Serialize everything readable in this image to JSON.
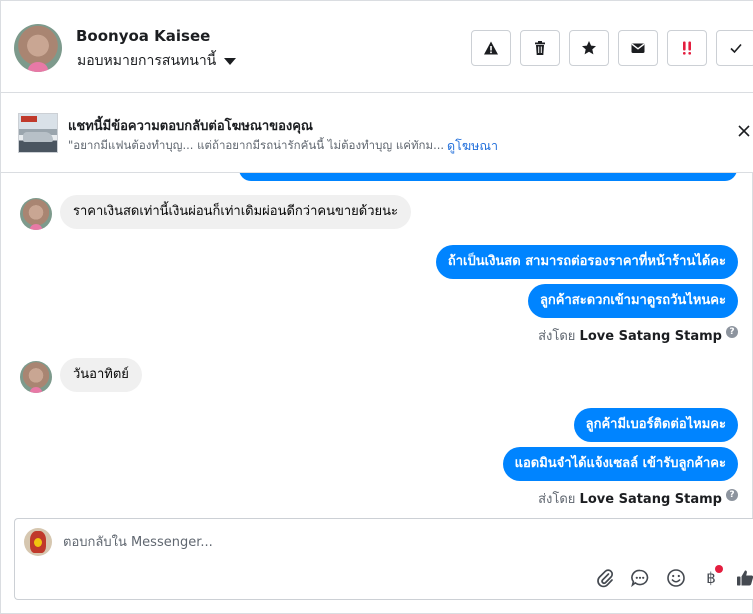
{
  "header": {
    "customer_name": "Boonyoa Kaisee",
    "assign_label": "มอบหมายการสนทนานี้",
    "actions": [
      {
        "name": "spam-button",
        "icon": "warning-icon"
      },
      {
        "name": "delete-button",
        "icon": "trash-icon"
      },
      {
        "name": "star-button",
        "icon": "star-icon"
      },
      {
        "name": "mark-unread-button",
        "icon": "envelope-icon"
      },
      {
        "name": "follow-up-button",
        "icon": "double-exclamation-icon"
      },
      {
        "name": "mark-done-button",
        "icon": "check-icon"
      }
    ]
  },
  "ad_banner": {
    "title": "แชทนี้มีข้อความตอบกลับต่อโฆษณาของคุณ",
    "preview": "\"อยากมีแฟนต้องทำบุญ... แต่ถ้าอยากมีรถน่ารักคันนี้ ไม่ต้องทำบุญ แค่ทักม...",
    "link": "ดูโฆษณา"
  },
  "thread": {
    "messages": [
      {
        "direction": "in",
        "text": "ราคาเงินสดเท่านี้เงินผ่อนก็เท่าเดิมผ่อนดีกว่าคนขายด้วยนะ"
      },
      {
        "direction": "out",
        "text": "ถ้าเป็นเงินสด สามารถต่อรองราคาที่หน้าร้านได้คะ"
      },
      {
        "direction": "out",
        "text": "ลูกค้าสะดวกเข้ามาดูรถวันไหนคะ"
      },
      {
        "direction": "in",
        "text": "วันอาทิตย์"
      },
      {
        "direction": "out",
        "text": "ลูกค้ามีเบอร์ติดต่อไหมคะ"
      },
      {
        "direction": "out",
        "text": "แอดมินจำได้แจ้งเซลล์ เข้ารับลูกค้าคะ"
      }
    ],
    "sent_by_prefix": "ส่งโดย",
    "sent_by_name": "Love Satang Stamp",
    "info_glyph": "?"
  },
  "composer": {
    "placeholder": "ตอบกลับใน Messenger...",
    "baht_glyph": "฿",
    "tools": [
      "paperclip-icon",
      "saved-reply-icon",
      "emoji-icon",
      "payment-icon",
      "thumbs-up-icon"
    ]
  },
  "colors": {
    "messenger_blue": "#0084ff",
    "incoming_bubble": "#f0f0f0",
    "link_blue": "#216fdb",
    "follow_up_red": "#e41e3f"
  }
}
